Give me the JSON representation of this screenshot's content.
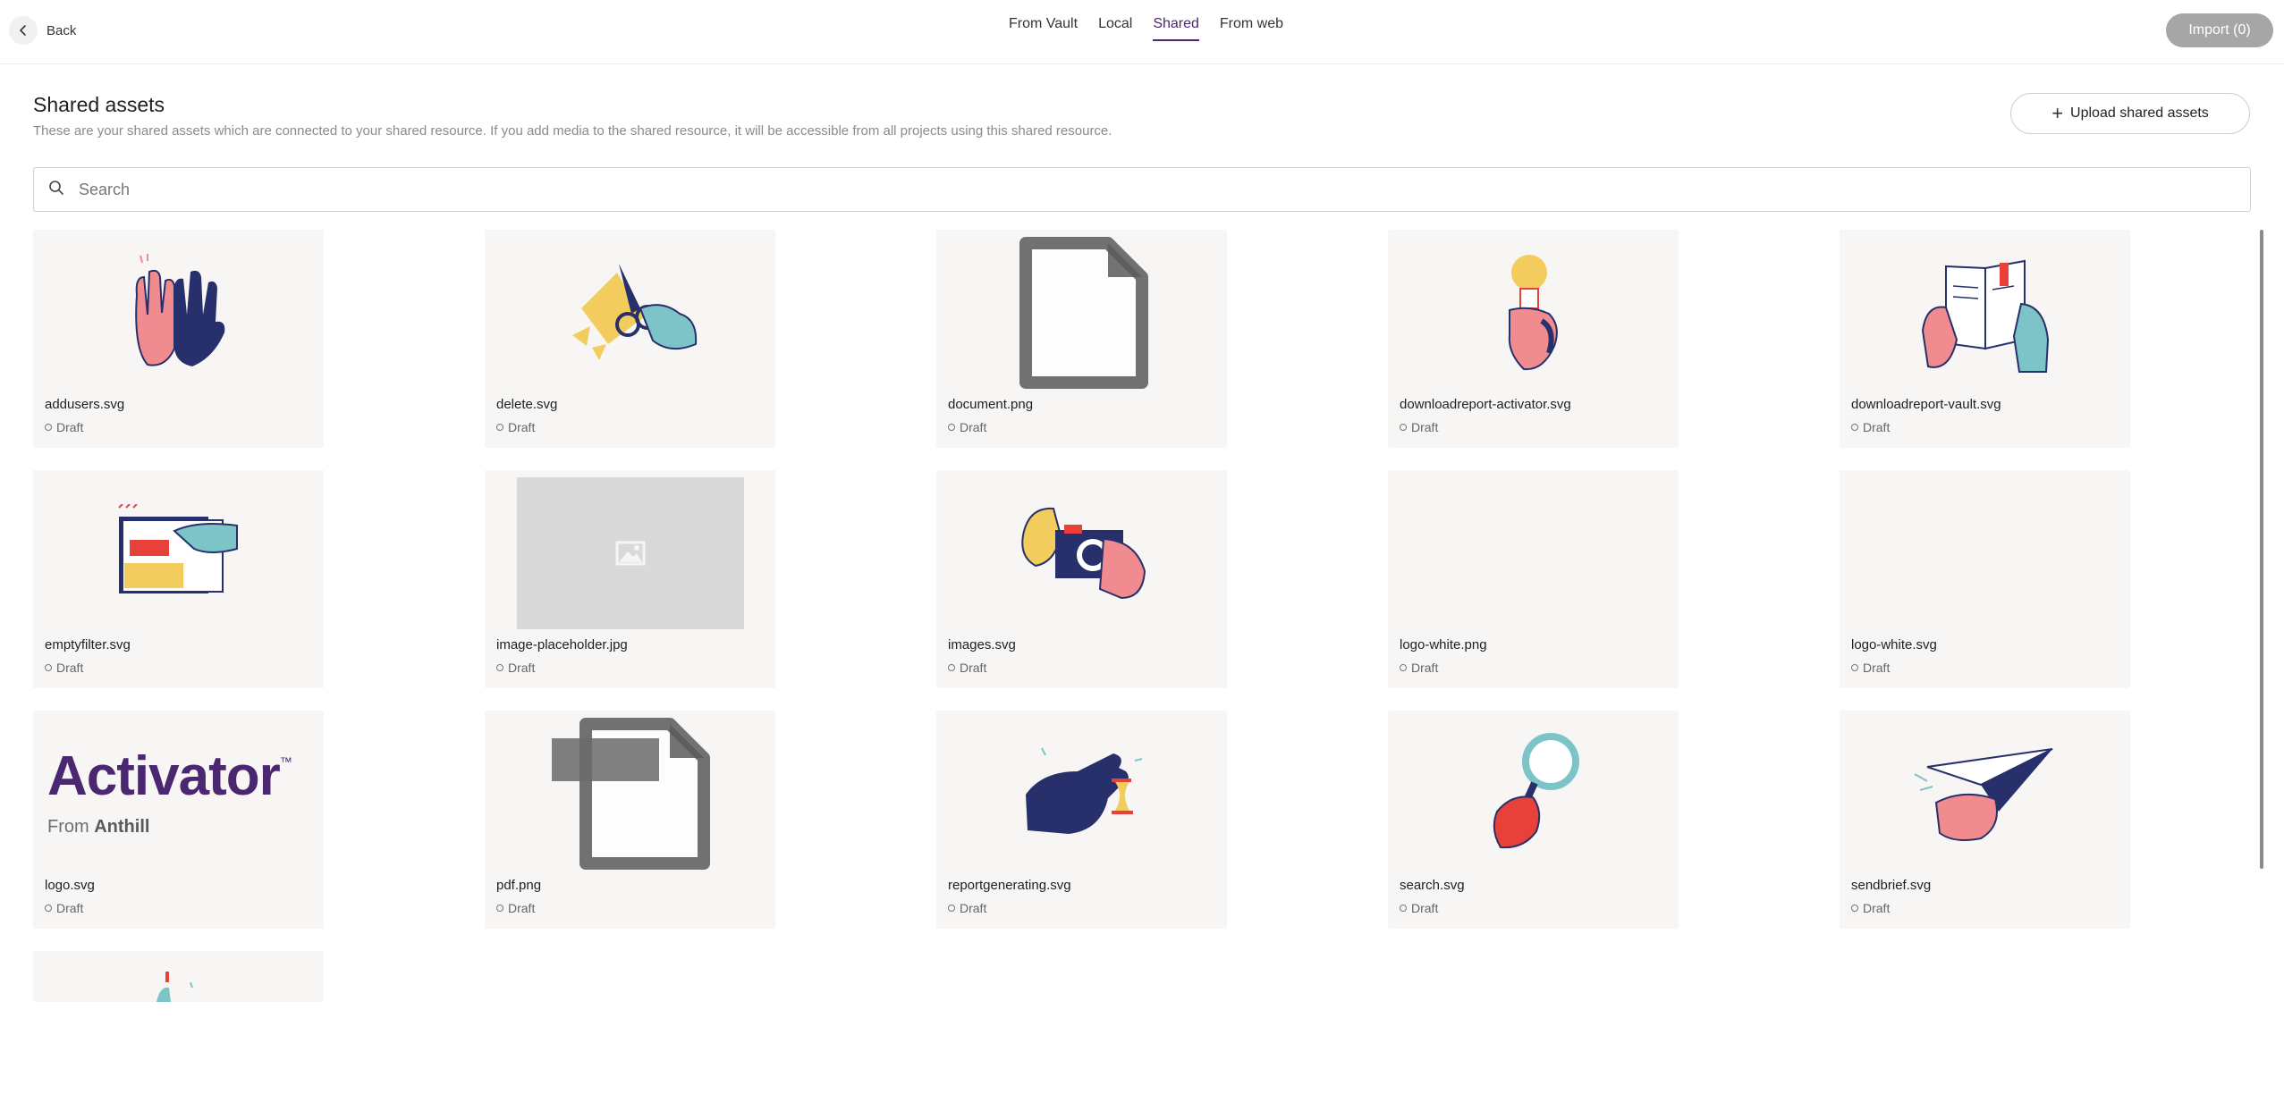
{
  "topbar": {
    "back_label": "Back",
    "tabs": [
      {
        "label": "From Vault",
        "active": false
      },
      {
        "label": "Local",
        "active": false
      },
      {
        "label": "Shared",
        "active": true
      },
      {
        "label": "From web",
        "active": false
      }
    ],
    "import_label": "Import (0)"
  },
  "section": {
    "title": "Shared assets",
    "description": "These are your shared assets which are connected to your shared resource. If you add media to the shared resource, it will be accessible from all projects using this shared resource.",
    "upload_label": "Upload shared assets"
  },
  "search": {
    "placeholder": "Search"
  },
  "assets": [
    {
      "name": "addusers.svg",
      "status": "Draft",
      "icon": "high-five-hands-icon"
    },
    {
      "name": "delete.svg",
      "status": "Draft",
      "icon": "scissors-cut-icon"
    },
    {
      "name": "document.png",
      "status": "Draft",
      "icon": "document-icon"
    },
    {
      "name": "downloadreport-activator.svg",
      "status": "Draft",
      "icon": "lightbulb-hand-icon"
    },
    {
      "name": "downloadreport-vault.svg",
      "status": "Draft",
      "icon": "book-hands-icon"
    },
    {
      "name": "emptyfilter.svg",
      "status": "Draft",
      "icon": "filter-form-icon"
    },
    {
      "name": "image-placeholder.jpg",
      "status": "Draft",
      "icon": "image-placeholder-icon"
    },
    {
      "name": "images.svg",
      "status": "Draft",
      "icon": "camera-hands-icon"
    },
    {
      "name": "logo-white.png",
      "status": "Draft",
      "icon": "blank-icon"
    },
    {
      "name": "logo-white.svg",
      "status": "Draft",
      "icon": "blank-icon"
    },
    {
      "name": "logo.svg",
      "status": "Draft",
      "icon": "activator-logo-icon"
    },
    {
      "name": "pdf.png",
      "status": "Draft",
      "icon": "pdf-file-icon"
    },
    {
      "name": "reportgenerating.svg",
      "status": "Draft",
      "icon": "hourglass-hand-icon"
    },
    {
      "name": "search.svg",
      "status": "Draft",
      "icon": "magnifier-hand-icon"
    },
    {
      "name": "sendbrief.svg",
      "status": "Draft",
      "icon": "paper-plane-hand-icon"
    },
    {
      "name": "",
      "status": "",
      "icon": "partial-illustration-icon"
    }
  ],
  "logo": {
    "brand": "Activator",
    "tm": "™",
    "from": "From",
    "company": "Anthill"
  },
  "colors": {
    "accent": "#4a2770",
    "navy": "#27306b",
    "pink": "#f08c8f",
    "teal": "#7cc4c8",
    "yellow": "#f2cd5d",
    "red": "#e8413a"
  }
}
